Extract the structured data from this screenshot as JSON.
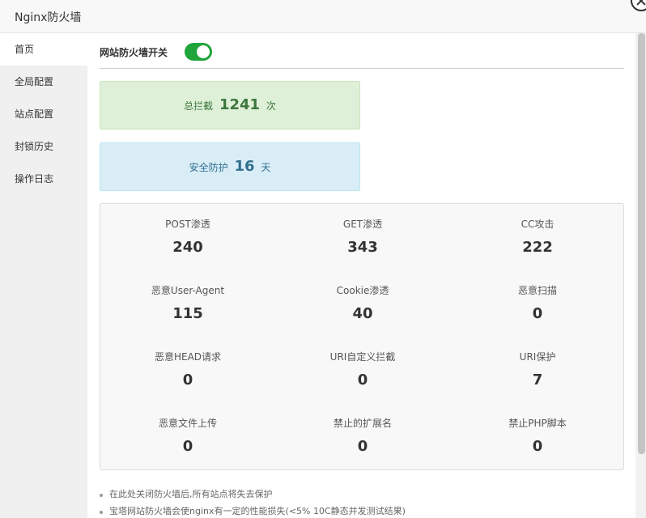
{
  "window": {
    "title": "Nginx防火墙"
  },
  "sidebar": {
    "items": [
      {
        "label": "首页"
      },
      {
        "label": "全局配置"
      },
      {
        "label": "站点配置"
      },
      {
        "label": "封锁历史"
      },
      {
        "label": "操作日志"
      }
    ]
  },
  "firewall_switch": {
    "label": "网站防火墙开关",
    "enabled": true,
    "color": "#20a53a"
  },
  "summary": {
    "total_blocked": {
      "prefix": "总拦截",
      "value": "1241",
      "suffix": "次"
    },
    "safe_days": {
      "prefix": "安全防护",
      "value": "16",
      "suffix": "天"
    }
  },
  "stats": [
    {
      "label": "POST渗透",
      "value": "240"
    },
    {
      "label": "GET渗透",
      "value": "343"
    },
    {
      "label": "CC攻击",
      "value": "222"
    },
    {
      "label": "恶意User-Agent",
      "value": "115"
    },
    {
      "label": "Cookie渗透",
      "value": "40"
    },
    {
      "label": "恶意扫描",
      "value": "0"
    },
    {
      "label": "恶意HEAD请求",
      "value": "0"
    },
    {
      "label": "URI自定义拦截",
      "value": "0"
    },
    {
      "label": "URI保护",
      "value": "7"
    },
    {
      "label": "恶意文件上传",
      "value": "0"
    },
    {
      "label": "禁止的扩展名",
      "value": "0"
    },
    {
      "label": "禁止PHP脚本",
      "value": "0"
    }
  ],
  "notes": [
    "在此处关闭防火墙后,所有站点将失去保护",
    "宝塔网站防火墙会使nginx有一定的性能损失(<5% 10C静态并发测试结果)"
  ]
}
